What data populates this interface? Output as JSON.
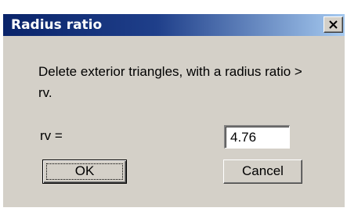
{
  "dialog": {
    "title": "Radius ratio",
    "close_icon": "close-x-icon",
    "message": "Delete exterior triangles, with a radius ratio > rv.",
    "rv_label": "rv =",
    "rv_value": "4.76",
    "ok_label": "OK",
    "cancel_label": "Cancel"
  },
  "colors": {
    "title_bar": "#0a246a",
    "title_bar_fade": "#a6caf0",
    "face": "#d4d0c8"
  }
}
